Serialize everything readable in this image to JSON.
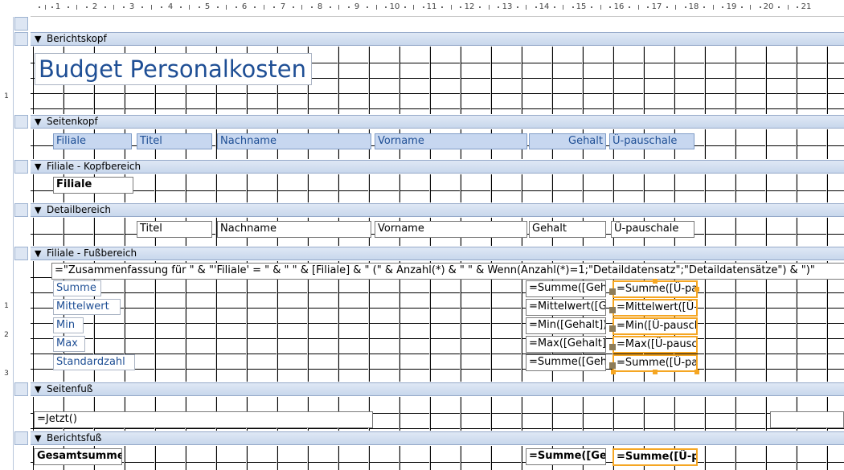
{
  "ruler": {
    "top_numbers": [
      "1",
      "2",
      "3",
      "4",
      "5",
      "6",
      "7",
      "8",
      "9",
      "10",
      "11",
      "12",
      "13",
      "14",
      "15",
      "16",
      "17",
      "18",
      "19",
      "20",
      "21"
    ],
    "left_numbers": [
      "1",
      "1",
      "2",
      "3"
    ]
  },
  "sections": {
    "berichtskopf": "Berichtskopf",
    "seitenkopf": "Seitenkopf",
    "filiale_kopf": "Filiale - Kopfbereich",
    "detail": "Detailbereich",
    "filiale_fuss": "Filiale - Fußbereich",
    "seitenfuss": "Seitenfuß",
    "berichtsfuss": "Berichtsfuß"
  },
  "report_title": "Budget Personalkosten",
  "page_header": {
    "filiale": "Filiale",
    "titel": "Titel",
    "nachname": "Nachname",
    "vorname": "Vorname",
    "gehalt": "Gehalt",
    "ue_pauschale": "Ü-pauschale"
  },
  "group_header": {
    "filiale": "Filiale"
  },
  "detail": {
    "titel": "Titel",
    "nachname": "Nachname",
    "vorname": "Vorname",
    "gehalt": "Gehalt",
    "ue_pauschale": "Ü-pauschale"
  },
  "group_footer": {
    "summary_expr": "=\"Zusammenfassung für \" & \"'Filiale' = \" & \" \" & [Filiale] & \" (\" & Anzahl(*) & \" \" & Wenn(Anzahl(*)=1;\"Detaildatensatz\";\"Detaildatensätze\") & \")\"",
    "rows": [
      {
        "label": "Summe",
        "gehalt": "=Summe([Gehalt])",
        "ue": "=Summe([Ü-pauschale])"
      },
      {
        "label": "Mittelwert",
        "gehalt": "=Mittelwert([Gehalt])",
        "ue": "=Mittelwert([Ü-pauschale])"
      },
      {
        "label": "Min",
        "gehalt": "=Min([Gehalt])",
        "ue": "=Min([Ü-pauschale])"
      },
      {
        "label": "Max",
        "gehalt": "=Max([Gehalt])",
        "ue": "=Max([Ü-pauschale])"
      },
      {
        "label": "Standardzahl",
        "gehalt": "=Summe([Gehalt])",
        "ue": "=Summe([Ü-pauschale])"
      }
    ]
  },
  "page_footer": {
    "now_expr": "=Jetzt()"
  },
  "report_footer": {
    "label": "Gesamtsumme",
    "gehalt": "=Summe([Gehalt])",
    "ue": "=Summe([Ü-pauschale])"
  },
  "colors": {
    "label_text": "#1f4f95",
    "band": "#c8d7ec",
    "selection": "#f5a623"
  },
  "icons": {
    "section_arrow": "section-collapse-icon"
  }
}
